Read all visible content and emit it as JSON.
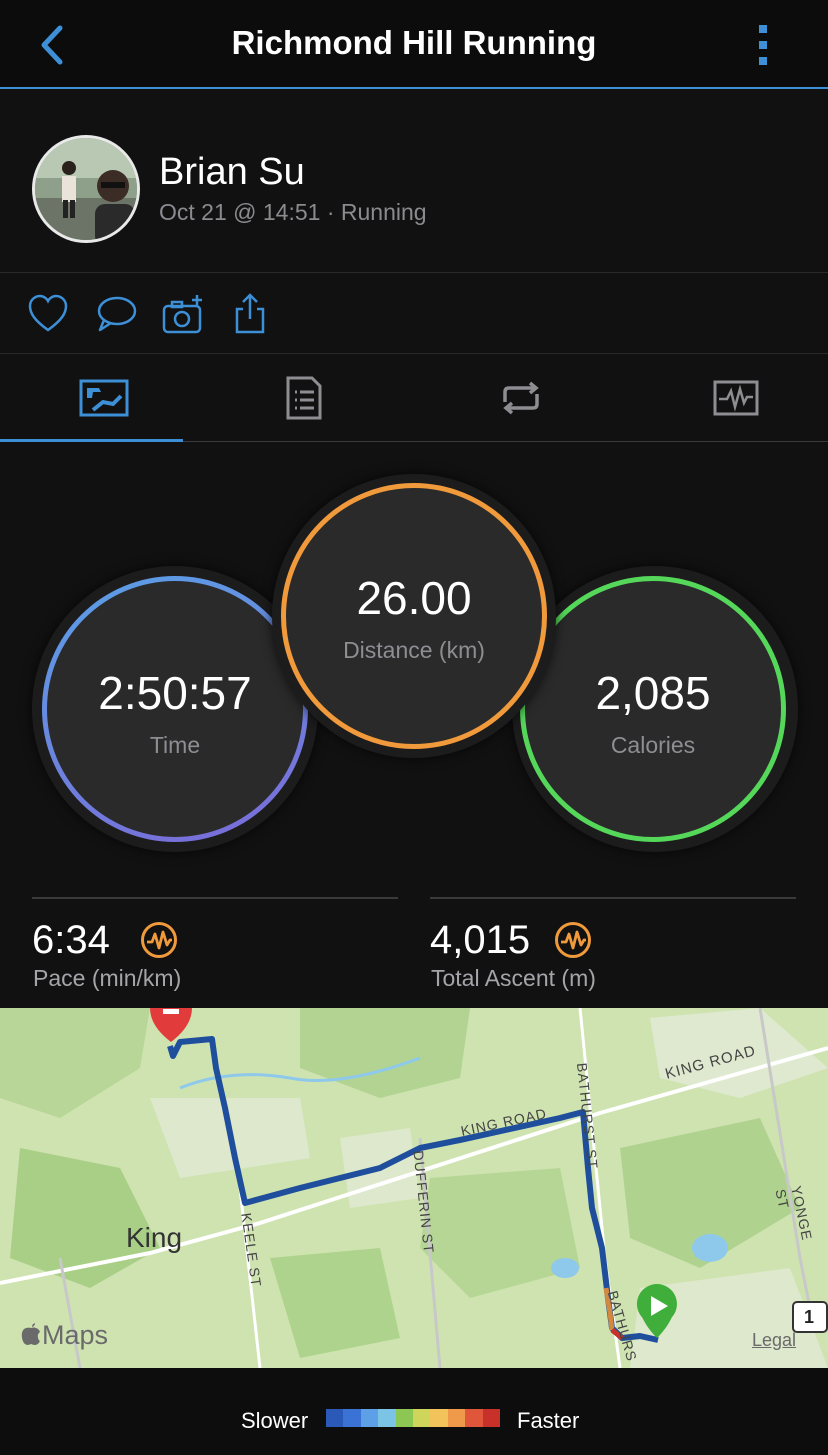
{
  "header": {
    "title": "Richmond Hill Running",
    "back_icon": "chevron-left-icon",
    "more_icon": "more-vertical-icon"
  },
  "profile": {
    "name": "Brian Su",
    "subtitle": "Oct 21 @ 14:51 · Running"
  },
  "actions": [
    "heart-icon",
    "comment-icon",
    "add-photo-icon",
    "share-icon"
  ],
  "tabs": [
    {
      "name": "summary",
      "icon": "map-summary-icon",
      "selected": true
    },
    {
      "name": "details",
      "icon": "document-icon",
      "selected": false
    },
    {
      "name": "laps",
      "icon": "repeat-icon",
      "selected": false
    },
    {
      "name": "charts",
      "icon": "chart-icon",
      "selected": false
    }
  ],
  "metrics": {
    "time": {
      "value": "2:50:57",
      "label": "Time"
    },
    "distance": {
      "value": "26.00",
      "label": "Distance (km)"
    },
    "calories": {
      "value": "2,085",
      "label": "Calories"
    }
  },
  "stats": {
    "pace": {
      "value": "6:34",
      "label": "Pace (min/km)"
    },
    "ascent": {
      "value": "4,015",
      "label": "Total Ascent (m)"
    }
  },
  "map": {
    "labels": {
      "town": "King",
      "king_road_1": "KING ROAD",
      "king_road_2": "KING ROAD",
      "keele": "KEELE ST",
      "dufferin": "DUFFERIN ST",
      "bathurst_1": "BATHURST ST",
      "bathurst_2": "BATHURS",
      "yonge": "YONGE ST",
      "highway": "1",
      "maps_brand": "Maps",
      "legal": "Legal"
    }
  },
  "legend": {
    "slower": "Slower",
    "faster": "Faster",
    "colors": [
      "#2b59b8",
      "#3a72d6",
      "#5da0e8",
      "#7cc4e6",
      "#8cc653",
      "#cfd45a",
      "#f1c35a",
      "#ef9a4a",
      "#e0563a",
      "#c8302a"
    ]
  },
  "colors": {
    "accent": "#3d8fd6",
    "time_ring": "#5a9be0",
    "distance_ring": "#f09a3c",
    "calories_ring": "#55d85a",
    "pulse_icon": "#f09a3c"
  }
}
